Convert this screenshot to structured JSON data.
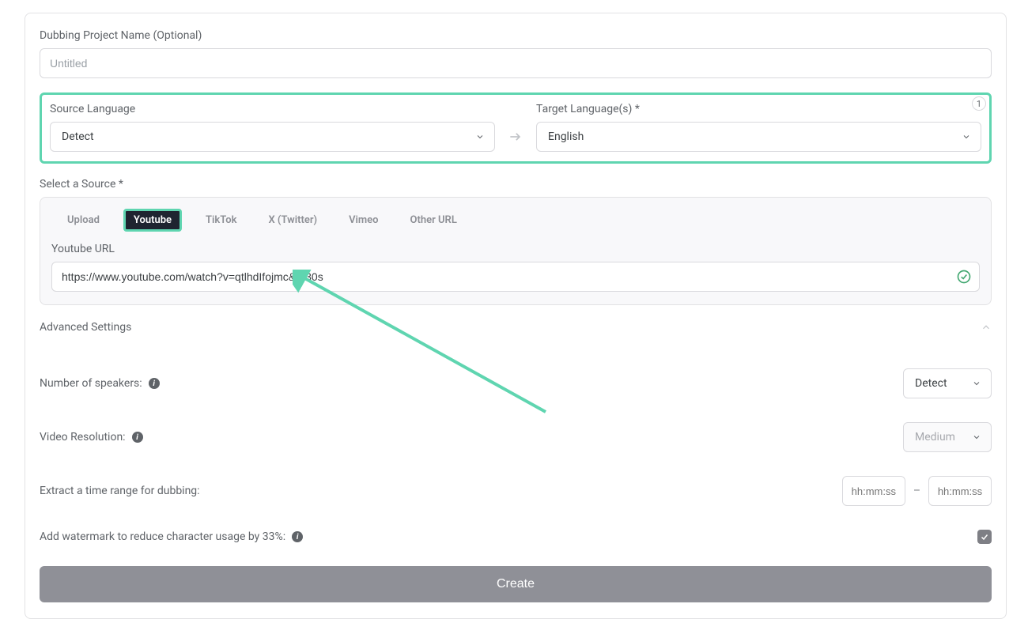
{
  "form": {
    "project_name_label": "Dubbing Project Name (Optional)",
    "project_name_placeholder": "Untitled",
    "source_lang_label": "Source Language",
    "source_lang_value": "Detect",
    "target_lang_label": "Target Language(s) *",
    "target_lang_value": "English",
    "target_count": "1",
    "select_source_label": "Select a Source *",
    "tabs": {
      "upload": "Upload",
      "youtube": "Youtube",
      "tiktok": "TikTok",
      "x": "X (Twitter)",
      "vimeo": "Vimeo",
      "other": "Other URL"
    },
    "youtube_url_label": "Youtube URL",
    "youtube_url_value": "https://www.youtube.com/watch?v=qtlhdIfojmc&t=30s",
    "advanced_label": "Advanced Settings",
    "speakers_label": "Number of speakers:",
    "speakers_value": "Detect",
    "resolution_label": "Video Resolution:",
    "resolution_value": "Medium",
    "timerange_label": "Extract a time range for dubbing:",
    "time_from_placeholder": "hh:mm:ss",
    "time_to_placeholder": "hh:mm:ss",
    "watermark_label": "Add watermark to reduce character usage by 33%:",
    "create_label": "Create"
  }
}
